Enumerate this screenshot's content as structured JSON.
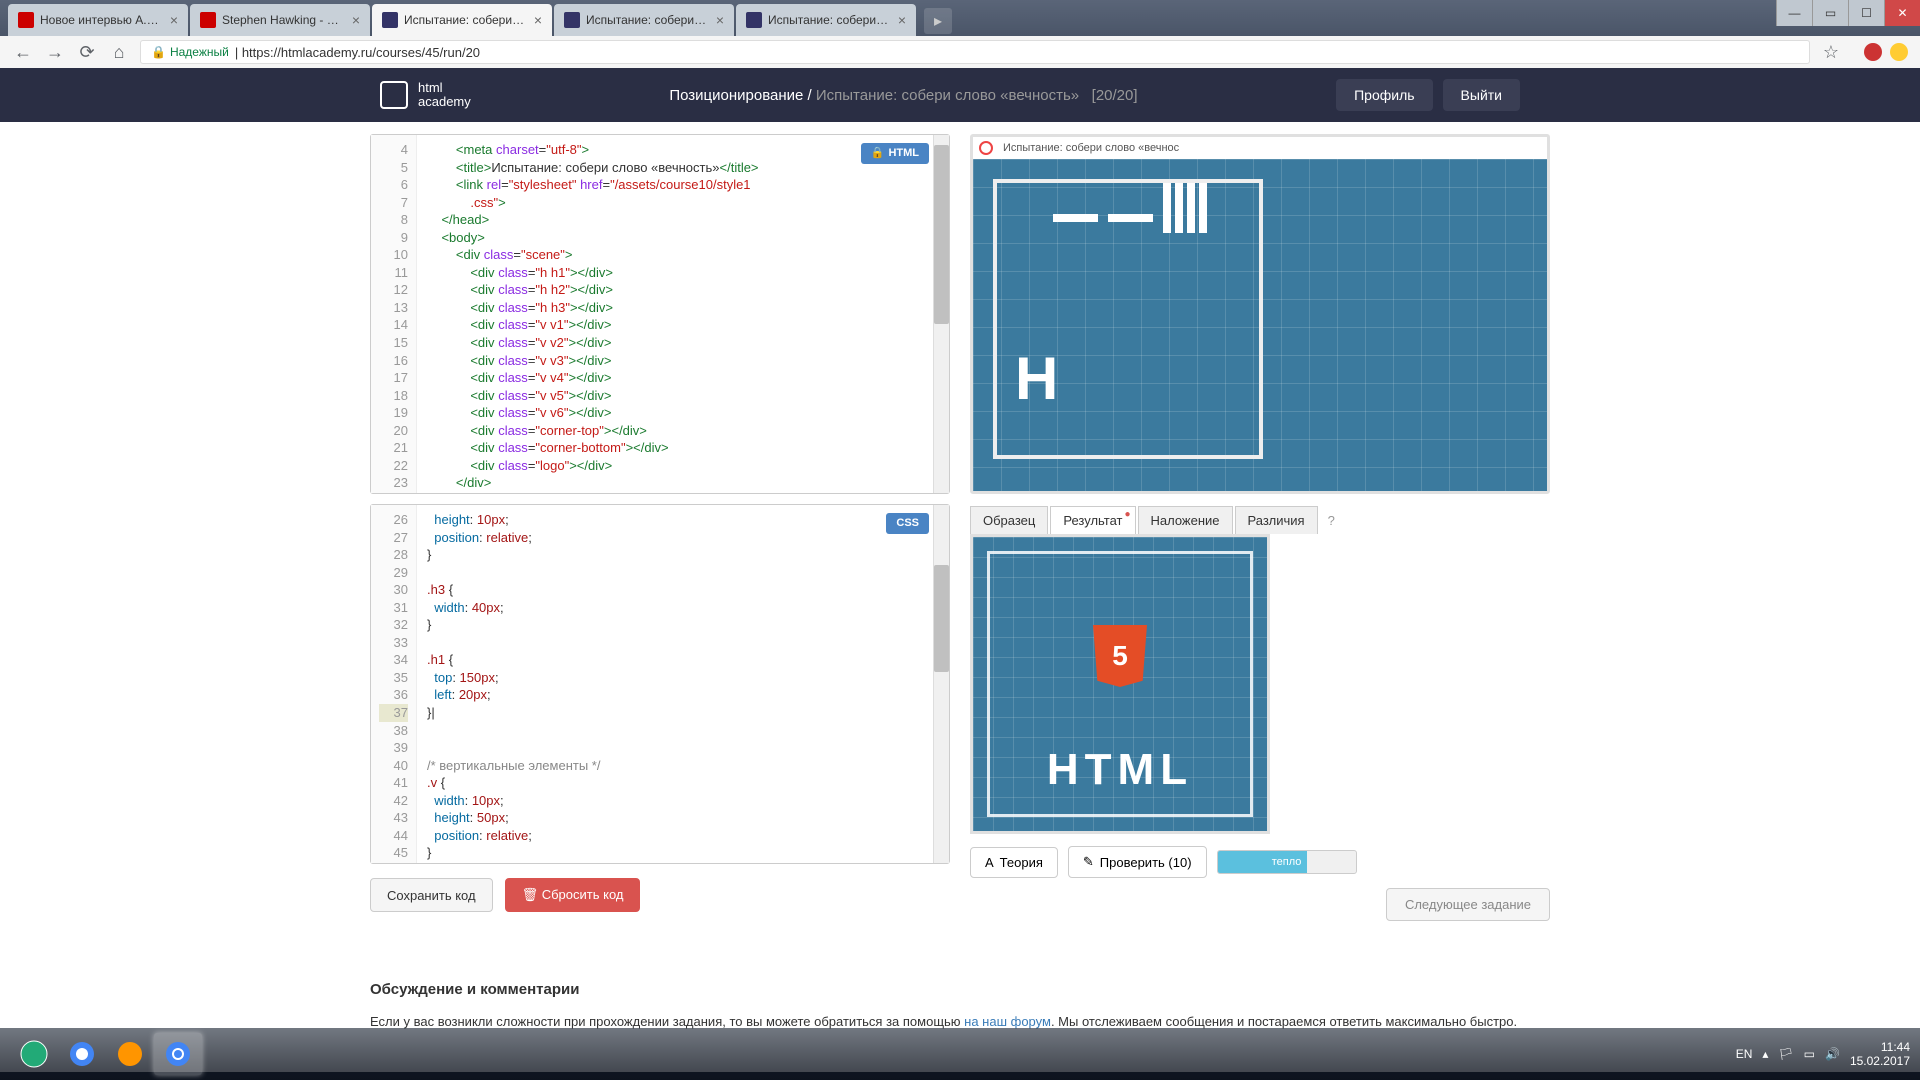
{
  "browser": {
    "tabs": [
      {
        "title": "Новое интервью А. Не...",
        "fav": "yt"
      },
      {
        "title": "Stephen Hawking - Wha...",
        "fav": "yt"
      },
      {
        "title": "Испытание: собери сло...",
        "fav": "ha",
        "active": true
      },
      {
        "title": "Испытание: собери сло...",
        "fav": "ha"
      },
      {
        "title": "Испытание: собери сло...",
        "fav": "ha"
      }
    ],
    "secure_label": "Надежный",
    "url": "https://htmlacademy.ru/courses/45/run/20"
  },
  "header": {
    "logo": "html\nacademy",
    "course": "Позиционирование",
    "task": "Испытание: собери слово «вечность»",
    "progress": "[20/20]",
    "profile": "Профиль",
    "logout": "Выйти"
  },
  "editor_html": {
    "badge": "HTML",
    "gutter": [
      "4",
      "5",
      "6",
      "",
      "7",
      "8",
      "9",
      "10",
      "11",
      "12",
      "13",
      "14",
      "15",
      "16",
      "17",
      "18",
      "19",
      "20",
      "21",
      "22",
      "23"
    ]
  },
  "editor_css": {
    "badge": "CSS",
    "gutter": [
      "26",
      "27",
      "28",
      "29",
      "30",
      "31",
      "32",
      "33",
      "34",
      "35",
      "36",
      "37",
      "38",
      "39",
      "40",
      "41",
      "42",
      "43",
      "44",
      "45"
    ]
  },
  "buttons": {
    "save": "Сохранить код",
    "reset": "Сбросить код"
  },
  "preview": {
    "title": "Испытание: собери слово «вечнос"
  },
  "result_tabs": {
    "sample": "Образец",
    "result": "Результат",
    "overlay": "Наложение",
    "diff": "Различия",
    "help": "?"
  },
  "result_preview": {
    "shield": "5",
    "text": "HTML"
  },
  "check": {
    "theory": "Теория",
    "check": "Проверить (10)",
    "progress_text": "тепло",
    "next": "Следующее задание"
  },
  "comments": {
    "title": "Обсуждение и комментарии",
    "text_before": "Если у вас возникли сложности при прохождении задания, то вы можете обратиться за помощью ",
    "link": "на наш форум",
    "text_after": ". Мы отслеживаем сообщения и постараемся ответить максимально быстро."
  },
  "taskbar": {
    "lang": "EN",
    "time": "11:44",
    "date": "15.02.2017"
  }
}
